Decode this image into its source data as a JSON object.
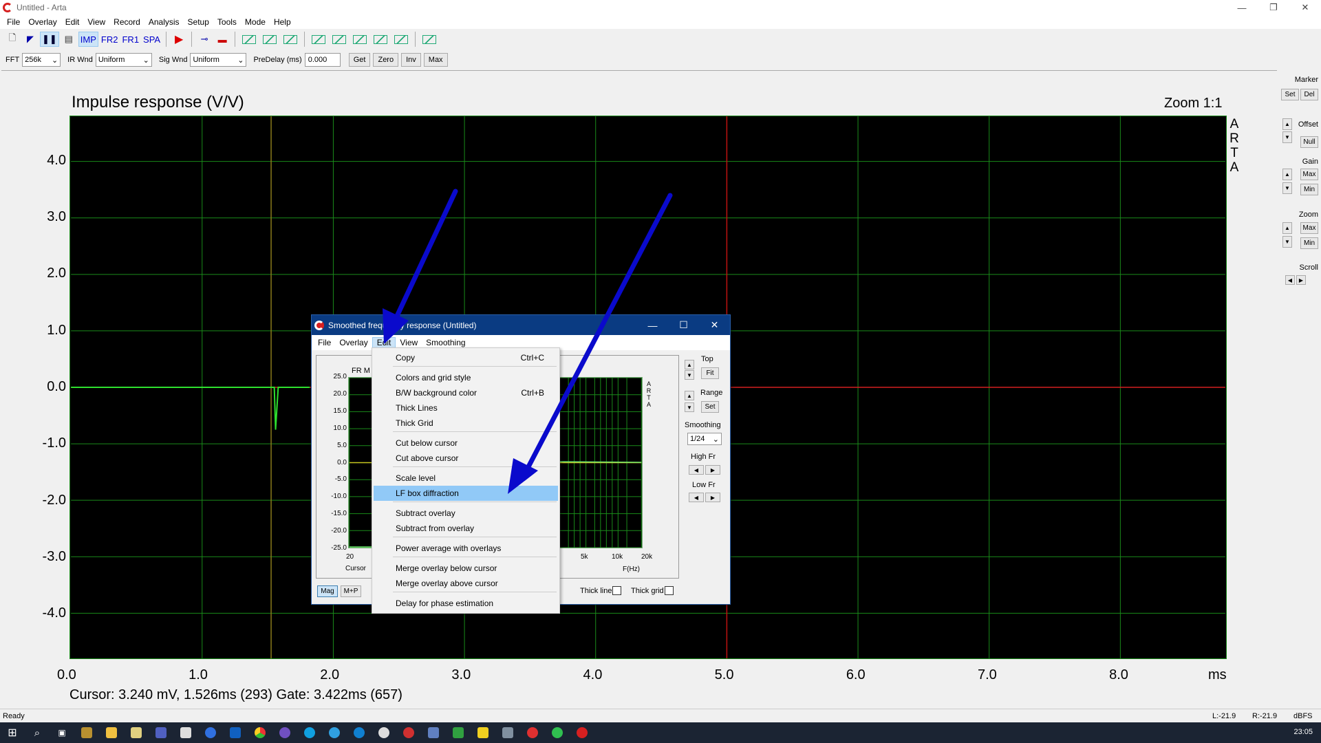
{
  "window": {
    "title": "Untitled - Arta"
  },
  "menu": [
    "File",
    "Overlay",
    "Edit",
    "View",
    "Record",
    "Analysis",
    "Setup",
    "Tools",
    "Mode",
    "Help"
  ],
  "toolbar": {
    "imp": "IMP",
    "fr2": "FR2",
    "fr1": "FR1",
    "spa": "SPA"
  },
  "options": {
    "fft_label": "FFT",
    "fft_value": "256k",
    "irwnd_label": "IR Wnd",
    "irwnd_value": "Uniform",
    "sigwnd_label": "Sig Wnd",
    "sigwnd_value": "Uniform",
    "predelay_label": "PreDelay (ms)",
    "predelay_value": "0.000",
    "get": "Get",
    "zero": "Zero",
    "inv": "Inv",
    "max": "Max"
  },
  "plot": {
    "title": "Impulse response (V/V)",
    "zoom": "Zoom 1:1",
    "watermark": [
      "A",
      "R",
      "T",
      "A"
    ],
    "cursor_text": "Cursor: 3.240 mV, 1.526ms (293)  Gate: 3.422ms (657)"
  },
  "side": {
    "marker": "Marker",
    "set": "Set",
    "del": "Del",
    "offset": "Offset",
    "null": "Null",
    "gain": "Gain",
    "max": "Max",
    "min": "Min",
    "zoom": "Zoom",
    "zmax": "Max",
    "zmin": "Min",
    "scroll": "Scroll"
  },
  "status": {
    "ready": "Ready",
    "l": "L:-21.9",
    "r": "R:-21.9",
    "dbfs": "dBFS"
  },
  "taskbar": {
    "time": "23:05"
  },
  "dialog": {
    "title": "Smoothed frequency response (Untitled)",
    "menu": [
      "File",
      "Overlay",
      "Edit",
      "View",
      "Smoothing"
    ],
    "plot_label": "FR M",
    "xaxis": "F(Hz)",
    "cursor_label": "Cursor",
    "x_ticks": [
      "20",
      "5k",
      "10k",
      "20k"
    ],
    "y_ticks": [
      "25.0",
      "20.0",
      "15.0",
      "10.0",
      "5.0",
      "0.0",
      "-5.0",
      "-10.0",
      "-15.0",
      "-20.0",
      "-25.0"
    ],
    "watermark": [
      "A",
      "R",
      "T",
      "A"
    ],
    "right": {
      "top": "Top",
      "fit": "Fit",
      "range": "Range",
      "set": "Set",
      "smoothing": "Smoothing",
      "smoothing_value": "1/24",
      "highfr": "High Fr",
      "lowfr": "Low Fr"
    },
    "bottom": {
      "mag": "Mag",
      "mp": "M+P",
      "thickline": "Thick line",
      "thickgrid": "Thick grid"
    }
  },
  "context_menu": [
    {
      "label": "Copy",
      "shortcut": "Ctrl+C"
    },
    {
      "label": "Colors and grid style",
      "shortcut": ""
    },
    {
      "label": "B/W background color",
      "shortcut": "Ctrl+B"
    },
    {
      "label": "Thick Lines",
      "shortcut": ""
    },
    {
      "label": "Thick Grid",
      "shortcut": ""
    },
    {
      "label": "Cut below cursor",
      "shortcut": ""
    },
    {
      "label": "Cut above cursor",
      "shortcut": ""
    },
    {
      "label": "Scale level",
      "shortcut": ""
    },
    {
      "label": "LF box  diffraction",
      "shortcut": ""
    },
    {
      "label": "Subtract overlay",
      "shortcut": ""
    },
    {
      "label": "Subtract from overlay",
      "shortcut": ""
    },
    {
      "label": "Power average with overlays",
      "shortcut": ""
    },
    {
      "label": "Merge overlay below cursor",
      "shortcut": ""
    },
    {
      "label": "Merge overlay above cursor",
      "shortcut": ""
    },
    {
      "label": "Delay for phase estimation",
      "shortcut": ""
    }
  ],
  "chart_data": {
    "type": "line",
    "title": "Impulse response (V/V)",
    "xlabel": "ms",
    "ylabel": "",
    "x_ticks": [
      "0.0",
      "1.0",
      "2.0",
      "3.0",
      "4.0",
      "5.0",
      "6.0",
      "7.0",
      "8.0",
      "ms"
    ],
    "y_ticks": [
      "4.0",
      "3.0",
      "2.0",
      "1.0",
      "0.0",
      "-1.0",
      "-2.0",
      "-3.0",
      "-4.0"
    ],
    "xlim": [
      0,
      8.8
    ],
    "ylim": [
      -4.8,
      4.8
    ],
    "grid": true,
    "cursor_x_ms": 1.526,
    "gate_x_ms": 5.0,
    "series": [
      {
        "x": [
          0,
          1.55,
          1.55,
          1.56,
          1.56,
          1.58,
          1.58,
          1.82
        ],
        "y": [
          0,
          0,
          0,
          -0.75,
          -0.75,
          0,
          0,
          0
        ]
      }
    ],
    "colors": {
      "background": "#000000",
      "grid": "#1a8c1a",
      "zero_line": "#d42020",
      "cursor": "#8a7a1a",
      "gate": "#c01010",
      "trace": "#2ee02e"
    }
  }
}
